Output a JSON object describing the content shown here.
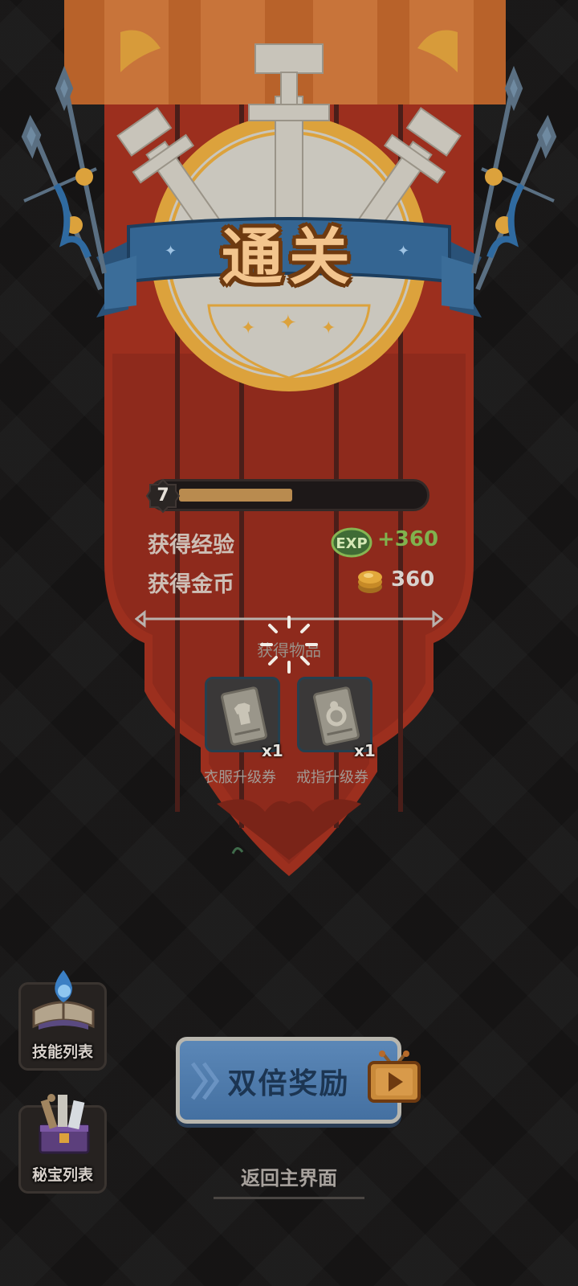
{
  "result": {
    "title": "通关",
    "level": "7",
    "level_progress_fraction": 0.47
  },
  "rewards": {
    "exp_label": "获得经验",
    "exp_icon_text": "EXP",
    "exp_value": "+360",
    "gold_label": "获得金币",
    "gold_value": "360"
  },
  "items": {
    "title": "获得物品",
    "list": [
      {
        "name": "衣服升级券",
        "qty": "x1"
      },
      {
        "name": "戒指升级券",
        "qty": "x1"
      }
    ]
  },
  "side_buttons": {
    "skill_list": "技能列表",
    "treasure_list": "秘宝列表"
  },
  "actions": {
    "double_reward": "双倍奖励",
    "return_home": "返回主界面"
  },
  "colors": {
    "banner_red": "#a1321f",
    "banner_orange": "#c76a2a",
    "gold": "#e2a83b",
    "ribbon_blue": "#2e5c86",
    "exp_green": "#80b24e",
    "button_blue": "#4a77a8"
  }
}
